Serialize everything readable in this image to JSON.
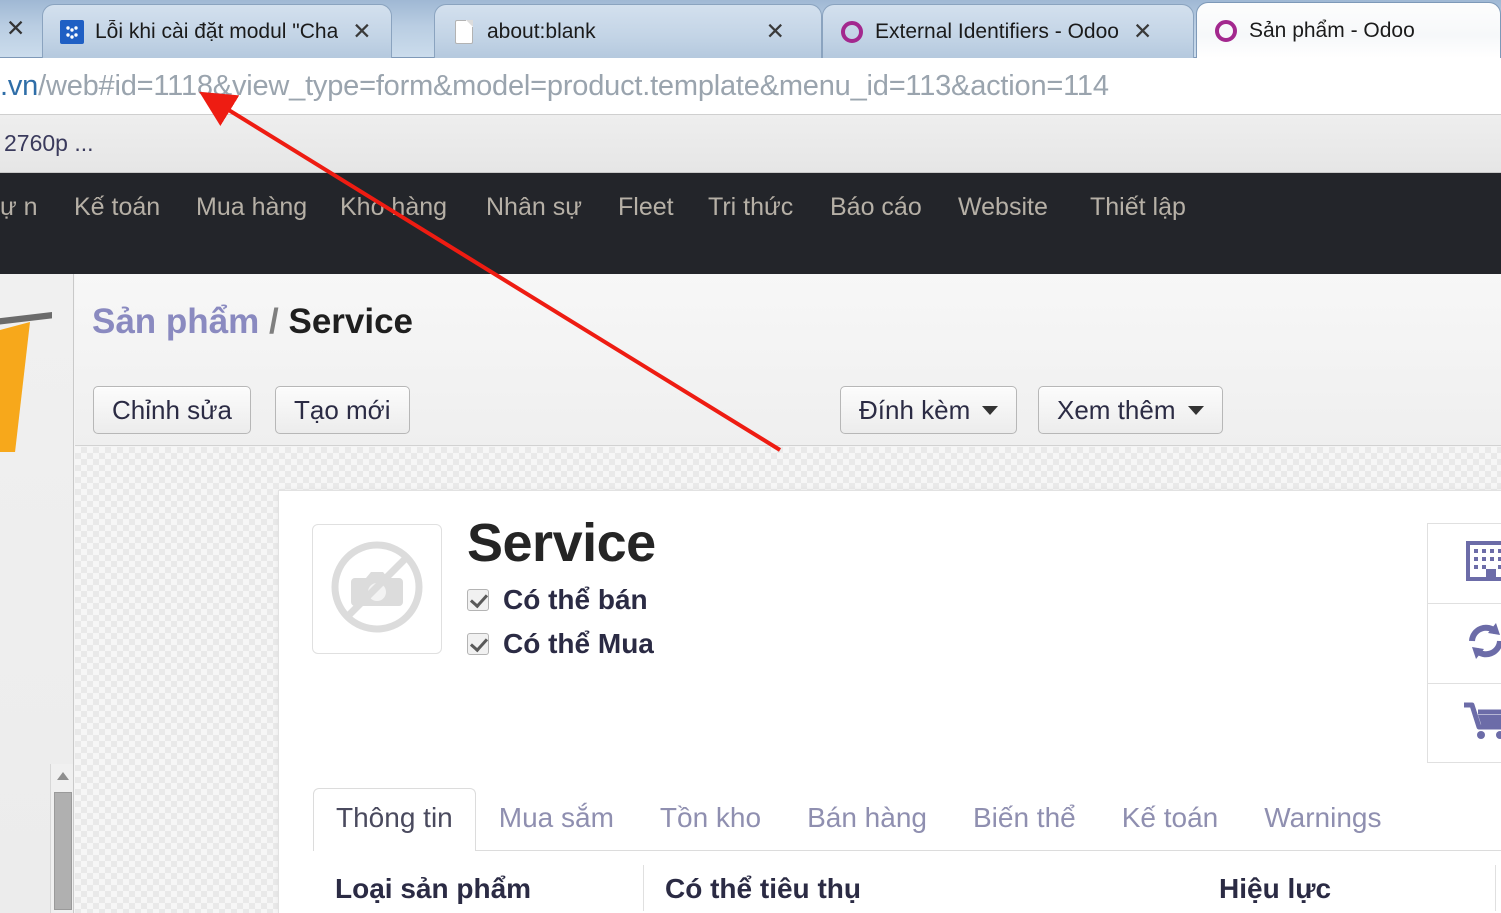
{
  "browser": {
    "tabs": [
      {
        "title": "Lỗi khi cài đặt modul \"Cha",
        "favicon": "blue-puzzle-icon",
        "active": false,
        "close_label": "✕"
      },
      {
        "title": "about:blank",
        "favicon": "blank-document-icon",
        "active": false,
        "close_label": "✕"
      },
      {
        "title": "External Identifiers - Odoo",
        "favicon": "odoo-icon",
        "active": false,
        "close_label": "✕"
      },
      {
        "title": "Sản phẩm - Odoo",
        "favicon": "odoo-icon",
        "active": true,
        "close_label": ""
      }
    ],
    "edge_tab_close_label": "✕",
    "url_domain": ".vn",
    "url_path": "/web#id=1118&view_type=form&model=product.template&menu_id=113&action=114",
    "status_text": "2760p ..."
  },
  "odoo_navbar": {
    "items": [
      "ự\nn",
      "Kế toán",
      "Mua hàng",
      "Kho hàng",
      "Nhân sự",
      "Fleet",
      "Tri thức",
      "Báo cáo",
      "Website",
      "Thiết lập"
    ]
  },
  "control_panel": {
    "breadcrumb_parent": "Sản phẩm",
    "breadcrumb_separator": "/",
    "breadcrumb_current": "Service",
    "buttons": {
      "edit": "Chỉnh sửa",
      "create": "Tạo mới",
      "attachment": "Đính kèm",
      "more": "Xem thêm"
    }
  },
  "form": {
    "product_title": "Service",
    "image_placeholder_icon": "no-camera-icon",
    "checkboxes": [
      {
        "label": "Có thể bán",
        "checked": true
      },
      {
        "label": "Có thể Mua",
        "checked": true
      }
    ],
    "stat_buttons": [
      {
        "icon": "building-icon"
      },
      {
        "icon": "refresh-sync-icon"
      },
      {
        "icon": "shopping-cart-icon"
      }
    ],
    "notebook_tabs": [
      {
        "label": "Thông tin",
        "active": true
      },
      {
        "label": "Mua sắm",
        "active": false
      },
      {
        "label": "Tồn kho",
        "active": false
      },
      {
        "label": "Bán hàng",
        "active": false
      },
      {
        "label": "Biến thể",
        "active": false
      },
      {
        "label": "Kế toán",
        "active": false
      },
      {
        "label": "Warnings",
        "active": false
      }
    ],
    "fields": [
      {
        "label": "Loại sản phẩm"
      },
      {
        "label": "Có thể tiêu thụ"
      },
      {
        "label": "Hiệu lực"
      }
    ]
  },
  "annotation": {
    "color": "#ee1c12",
    "description": "red-arrow-pointing-to-url-id"
  }
}
